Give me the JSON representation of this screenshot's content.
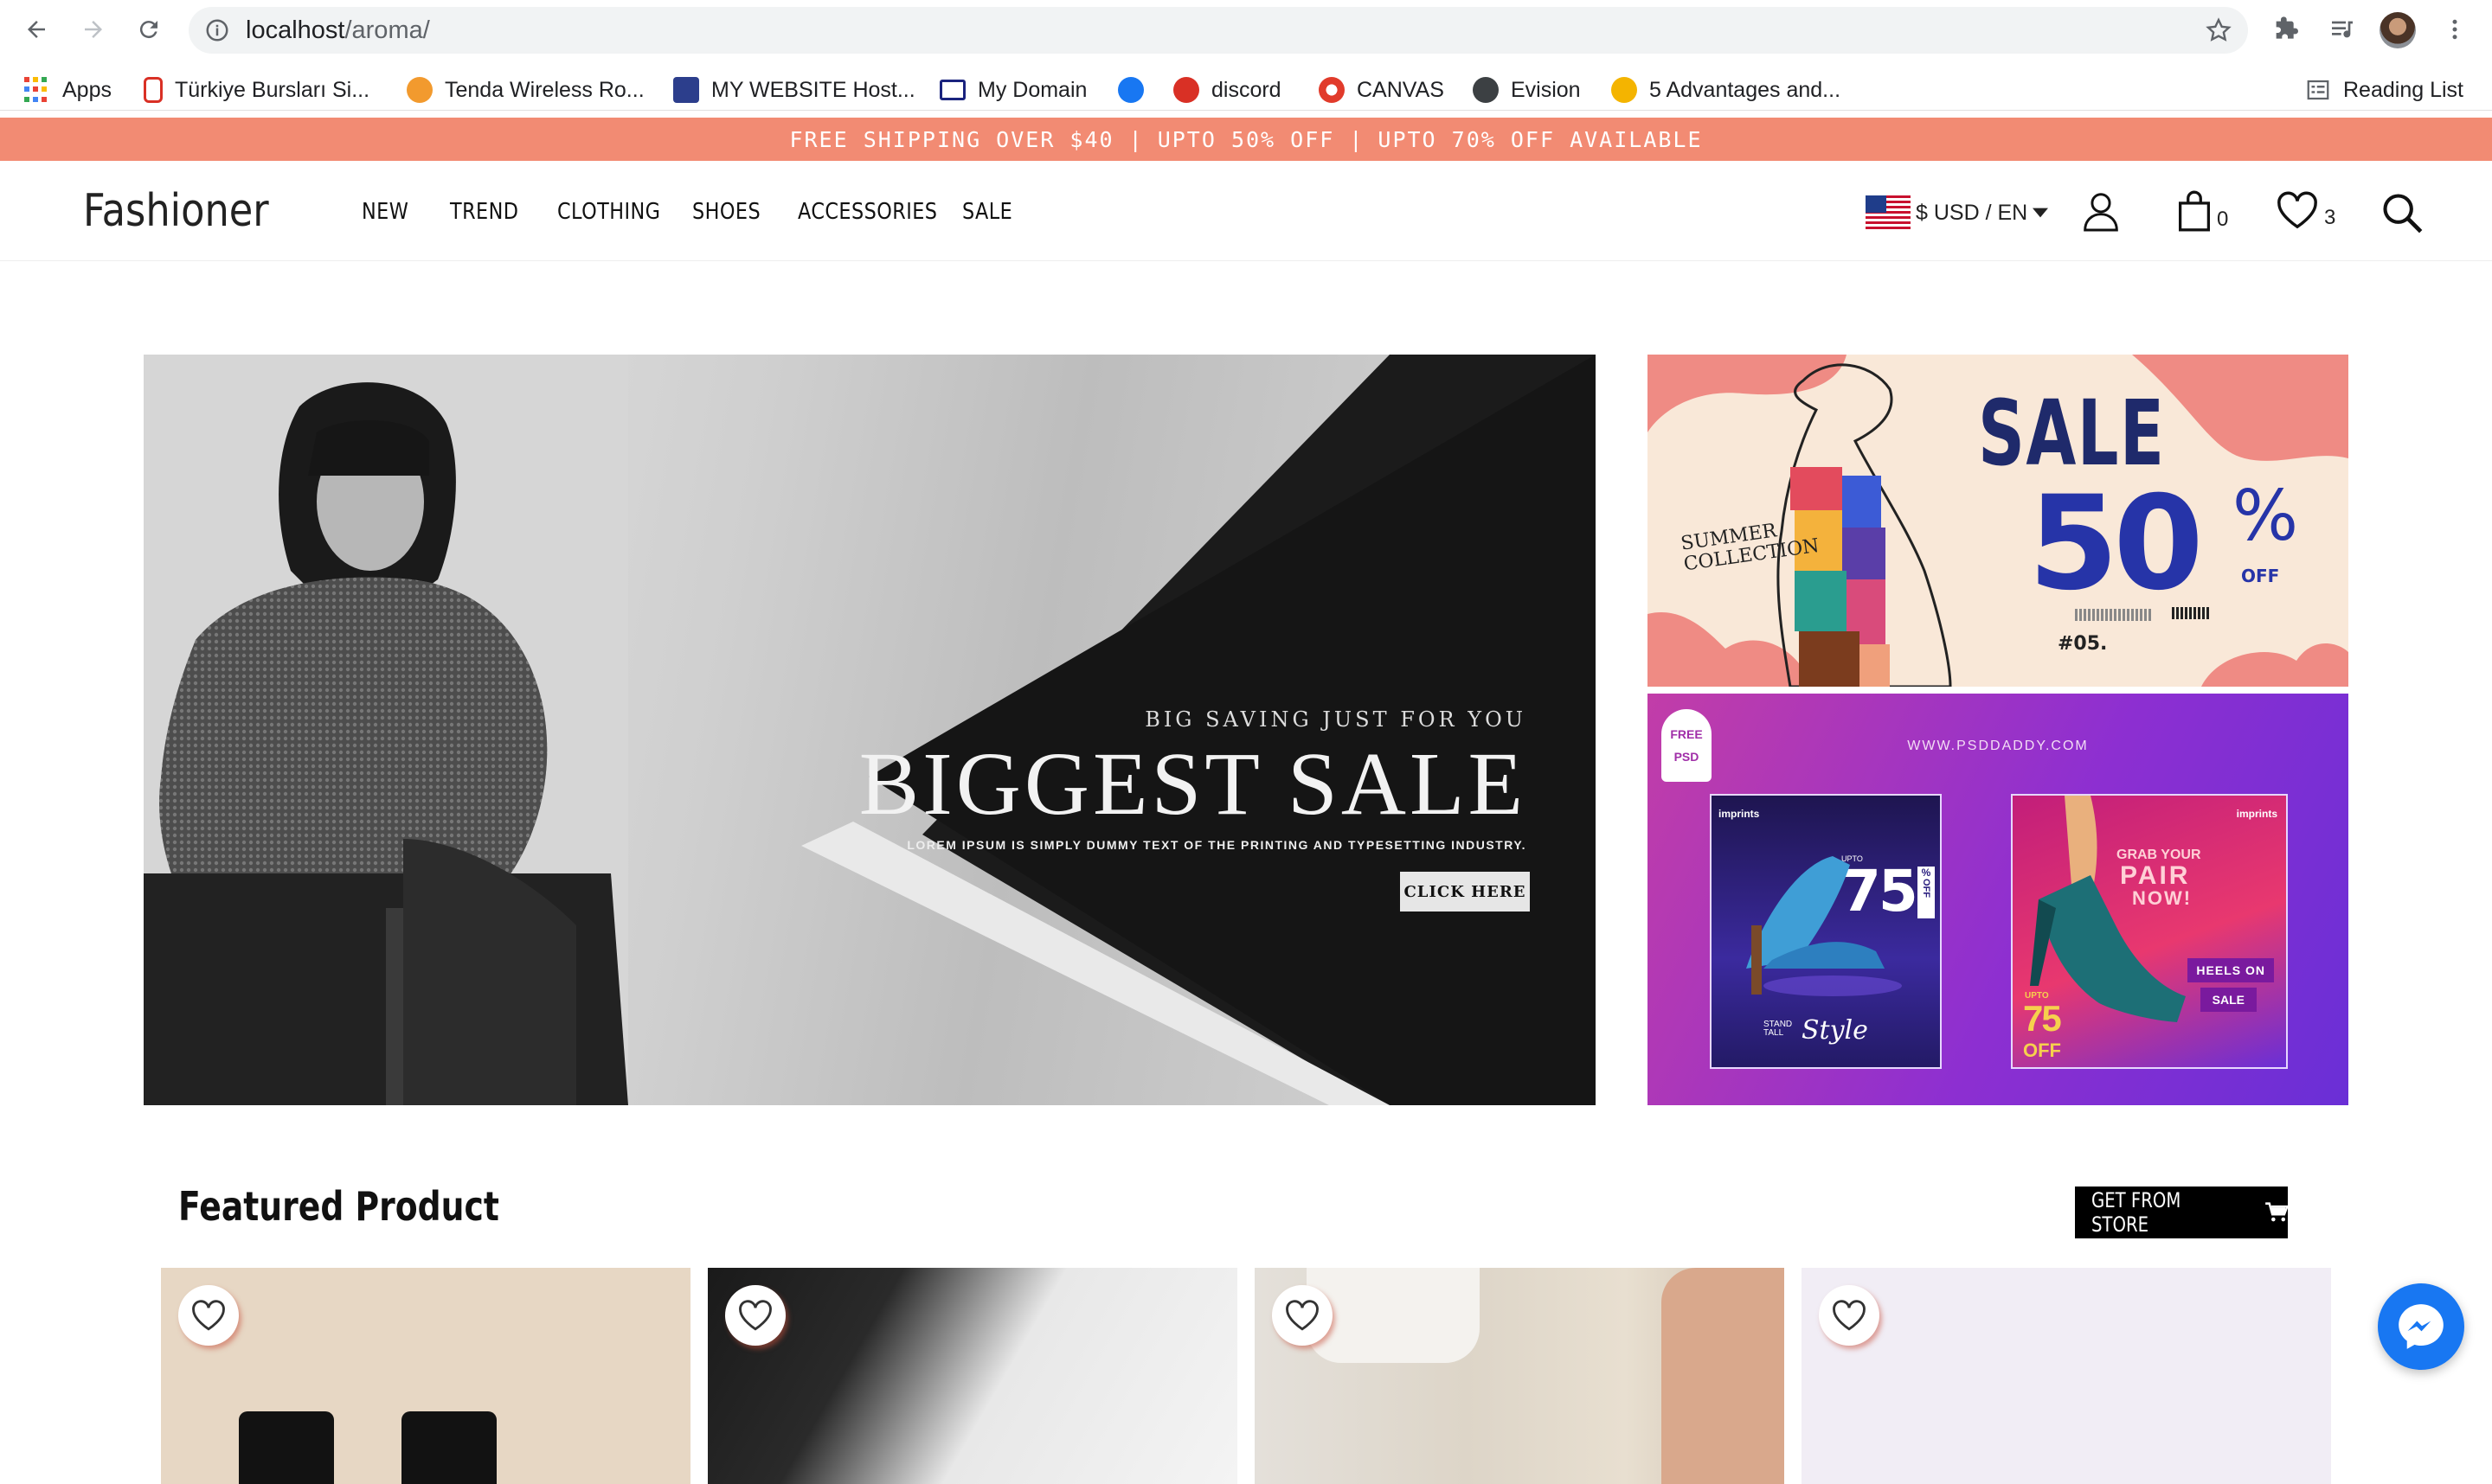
{
  "browser": {
    "url_host": "localhost",
    "url_path": "/aroma/",
    "bookmarks": [
      {
        "label": "Apps",
        "icon": "apps-grid-icon"
      },
      {
        "label": "Türkiye Bursları Si...",
        "icon": "scholarship-icon"
      },
      {
        "label": "Tenda Wireless Ro...",
        "icon": "router-icon"
      },
      {
        "label": "MY WEBSITE Host...",
        "icon": "hosting-icon"
      },
      {
        "label": "My Domain",
        "icon": "domain-icon"
      },
      {
        "label": "",
        "icon": "facebook-icon"
      },
      {
        "label": "discord",
        "icon": "discord-icon"
      },
      {
        "label": "CANVAS",
        "icon": "canvas-icon"
      },
      {
        "label": "Evision",
        "icon": "globe-icon"
      },
      {
        "label": "5 Advantages and...",
        "icon": "article-icon"
      }
    ],
    "reading_list": "Reading List"
  },
  "promo": {
    "items": [
      "FREE SHIPPING OVER $40 |",
      "UPTO 50% OFF |",
      "UPTO 70% OFF AVAILABLE"
    ],
    "bg_color": "#f28b73"
  },
  "header": {
    "logo": "Fashioner",
    "nav": [
      "NEW",
      "TREND",
      "CLOTHING",
      "SHOES",
      "ACCESSORIES",
      "SALE"
    ],
    "currency": "$ USD / EN",
    "cart_count": "0",
    "wishlist_count": "3"
  },
  "hero": {
    "kicker": "BIG SAVING JUST FOR YOU",
    "title": "BIGGEST SALE",
    "subtitle": "LOREM IPSUM IS SIMPLY DUMMY TEXT OF THE PRINTING AND TYPESETTING INDUSTRY.",
    "button": "CLICK HERE"
  },
  "banner1": {
    "tag": "SUMMER COLLECTION",
    "sale": "SALE",
    "percent": "50",
    "pct_sign": "%",
    "off": "OFF",
    "code": "#05."
  },
  "banner2": {
    "site": "WWW.PSDDADDY.COM",
    "badge_top": "FREE",
    "badge_bottom": "PSD",
    "brand": "imprints",
    "left": {
      "upto": "UPTO",
      "percent": "75",
      "pct": "%",
      "off": "OFF",
      "tagline_small": "STAND TALL",
      "tagline": "Style"
    },
    "right": {
      "grab": "GRAB YOUR",
      "pair": "PAIR",
      "now": "NOW!",
      "heels": "HEELS ON",
      "sale": "SALE",
      "upto": "UPTO",
      "percent": "75",
      "off": "OFF"
    }
  },
  "featured": {
    "title": "Featured Product",
    "store_button": "GET FROM STORE"
  }
}
